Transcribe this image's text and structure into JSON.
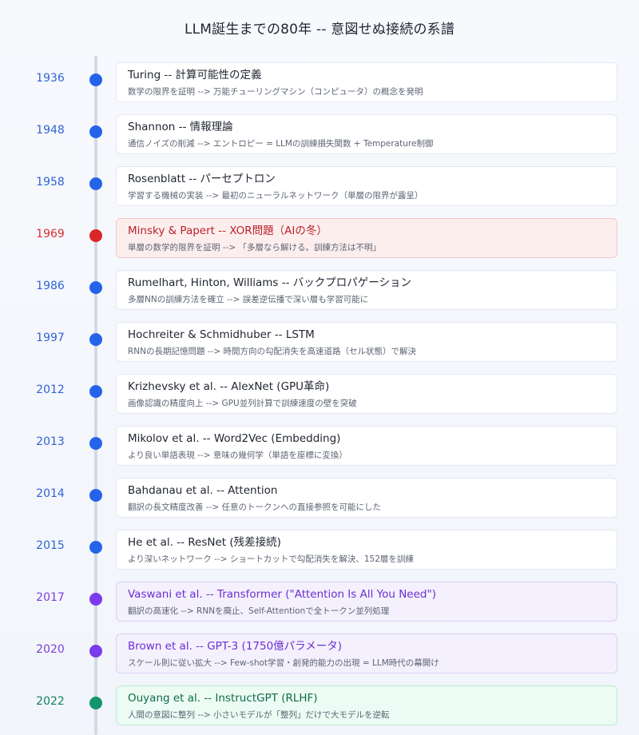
{
  "title": "LLM誕生までの80年 -- 意図せぬ接続の系譜",
  "colors": {
    "default": "#2563eb",
    "ai_winter": "#dc2626",
    "transformer_era": "#7c3aed",
    "rlhf": "#13946a"
  },
  "events": [
    {
      "year": "1936",
      "title": "Turing -- 計算可能性の定義",
      "subtitle": "数学の限界を証明 --> 万能チューリングマシン（コンピュータ）の概念を発明",
      "theme": "blue"
    },
    {
      "year": "1948",
      "title": "Shannon -- 情報理論",
      "subtitle": "通信ノイズの削減 --> エントロピー = LLMの訓練損失関数 + Temperature制御",
      "theme": "blue"
    },
    {
      "year": "1958",
      "title": "Rosenblatt -- パーセプトロン",
      "subtitle": "学習する機械の実装 --> 最初のニューラルネットワーク（単層の限界が露呈）",
      "theme": "blue"
    },
    {
      "year": "1969",
      "title": "Minsky & Papert -- XOR問題（AIの冬）",
      "subtitle": "単層の数学的限界を証明 --> 「多層なら解ける。訓練方法は不明」",
      "theme": "red"
    },
    {
      "year": "1986",
      "title": "Rumelhart, Hinton, Williams -- バックプロパゲーション",
      "subtitle": "多層NNの訓練方法を確立 --> 誤差逆伝播で深い層も学習可能に",
      "theme": "blue"
    },
    {
      "year": "1997",
      "title": "Hochreiter & Schmidhuber -- LSTM",
      "subtitle": "RNNの長期記憶問題 --> 時間方向の勾配消失を高速道路（セル状態）で解決",
      "theme": "blue"
    },
    {
      "year": "2012",
      "title": "Krizhevsky et al. -- AlexNet (GPU革命)",
      "subtitle": "画像認識の精度向上 --> GPU並列計算で訓練速度の壁を突破",
      "theme": "blue"
    },
    {
      "year": "2013",
      "title": "Mikolov et al. -- Word2Vec (Embedding)",
      "subtitle": "より良い単語表現 --> 意味の幾何学（単語を座標に変換）",
      "theme": "blue"
    },
    {
      "year": "2014",
      "title": "Bahdanau et al. -- Attention",
      "subtitle": "翻訳の長文精度改善 --> 任意のトークンへの直接参照を可能にした",
      "theme": "blue"
    },
    {
      "year": "2015",
      "title": "He et al. -- ResNet (残差接続)",
      "subtitle": "より深いネットワーク --> ショートカットで勾配消失を解決、152層を訓練",
      "theme": "blue"
    },
    {
      "year": "2017",
      "title": "Vaswani et al. -- Transformer (\"Attention Is All You Need\")",
      "subtitle": "翻訳の高速化 --> RNNを廃止、Self-Attentionで全トークン並列処理",
      "theme": "purple"
    },
    {
      "year": "2020",
      "title": "Brown et al. -- GPT-3 (1750億パラメータ)",
      "subtitle": "スケール則に従い拡大 --> Few-shot学習・創発的能力の出現 = LLM時代の幕開け",
      "theme": "purple"
    },
    {
      "year": "2022",
      "title": "Ouyang et al. -- InstructGPT (RLHF)",
      "subtitle": "人間の意図に整列 --> 小さいモデルが「整列」だけで大モデルを逆転",
      "theme": "green"
    }
  ]
}
